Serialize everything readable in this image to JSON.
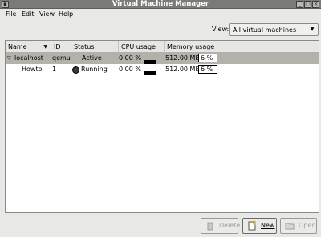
{
  "window": {
    "title": "Virtual Machine Manager"
  },
  "menu": [
    "File",
    "Edit",
    "View",
    "Help"
  ],
  "view": {
    "label": "View:",
    "value": "All virtual machines"
  },
  "table": {
    "columns": [
      "Name",
      "ID",
      "Status",
      "CPU usage",
      "Memory usage"
    ],
    "rows": [
      {
        "name": "localhost",
        "id": "qemu",
        "status": "Active",
        "cpu": "0.00 %",
        "memory": "512.00 MB",
        "mem_pct": "6 %"
      },
      {
        "name": "Howto",
        "id": "1",
        "status": "Running",
        "cpu": "0.00 %",
        "memory": "512.00 MB",
        "mem_pct": "6 %"
      }
    ]
  },
  "buttons": {
    "delete": "Delete",
    "new": "New",
    "open": "Open"
  }
}
